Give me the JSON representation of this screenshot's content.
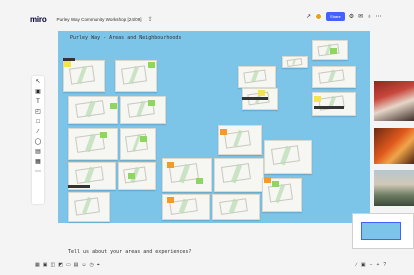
{
  "header": {
    "brand": "miro",
    "board_title": "Purley Way Community Workshop [24/09]",
    "share_label": "Share",
    "icons": [
      "upload-icon",
      "cursor-icon",
      "settings-icon",
      "comment-icon",
      "notifications-icon",
      "more-icon"
    ]
  },
  "toolbar": {
    "tools": [
      "cursor-icon",
      "frame-icon",
      "text-icon",
      "sticky-note-icon",
      "shape-icon",
      "pen-icon",
      "comment-icon",
      "frame-icon",
      "grid-icon",
      "more-icon"
    ]
  },
  "canvas": {
    "title": "Purley Way - Areas and Neighbourhoods",
    "bottom_question": "Tell us about your areas and experiences?",
    "colors": {
      "background": "#7cc4e8",
      "sticky_green": "#8ed660",
      "sticky_orange": "#f39a2a",
      "sticky_yellow": "#f4e34d"
    }
  },
  "bottombar": {
    "icons": [
      "grid-icon",
      "frame-icon",
      "comment-icon",
      "chat-icon",
      "card-icon",
      "table-icon",
      "emoji-icon",
      "timer-icon",
      "location-icon"
    ],
    "zoom_controls": [
      "pen-icon",
      "frame-icon",
      "zoom-out-icon",
      "zoom-in-icon",
      "help-icon"
    ]
  }
}
